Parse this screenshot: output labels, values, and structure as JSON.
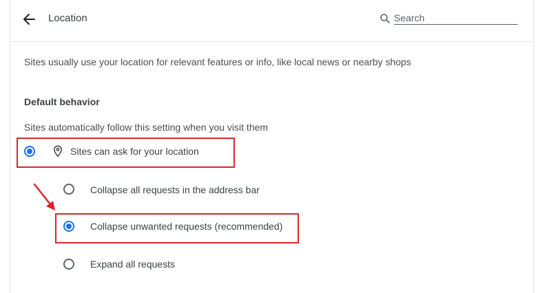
{
  "header": {
    "title": "Location",
    "search": {
      "placeholder": "Search",
      "value": ""
    }
  },
  "description": "Sites usually use your location for relevant features or info, like local news or nearby shops",
  "default_behavior": {
    "heading": "Default behavior",
    "subtext": "Sites automatically follow this setting when you visit them",
    "main_option": {
      "label": "Sites can ask for your location",
      "selected": true,
      "icon": "location-pin-icon"
    },
    "sub_options": [
      {
        "label": "Collapse all requests in the address bar",
        "selected": false
      },
      {
        "label": "Collapse unwanted requests (recommended)",
        "selected": true
      },
      {
        "label": "Expand all requests",
        "selected": false
      }
    ]
  },
  "colors": {
    "accent": "#1a73e8",
    "annotation": "#d9262c",
    "text": "#3c4043"
  }
}
